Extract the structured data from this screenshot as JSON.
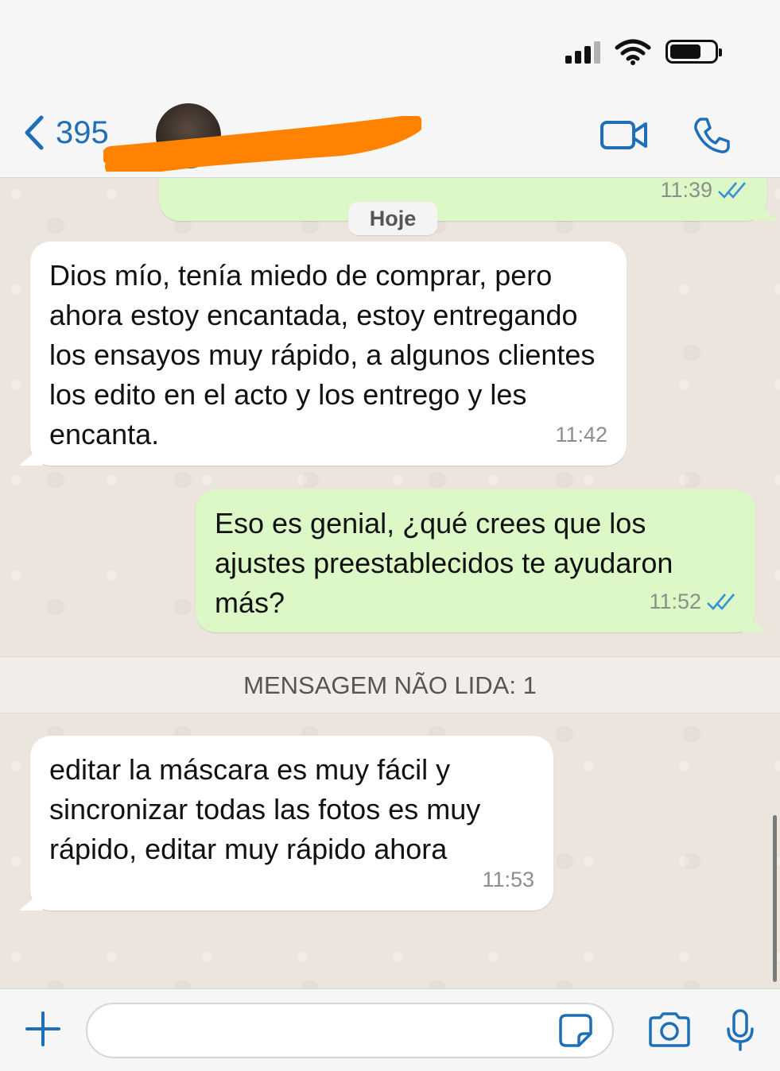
{
  "header": {
    "back_count": "395",
    "accent": "#1F6FB8"
  },
  "chat": {
    "date_chip": "Hoje",
    "top_partial_time": "11:39",
    "messages": [
      {
        "direction": "incoming",
        "text": "Dios mío, tenía miedo de comprar, pero ahora estoy encantada, estoy entregando los ensayos muy rápido, a algunos clientes los edito en el acto y los entrego y les encanta.",
        "time": "11:42"
      },
      {
        "direction": "outgoing",
        "text": "Eso es genial, ¿qué crees que los ajustes preestablecidos te ayudaron más?",
        "time": "11:52"
      },
      {
        "direction": "incoming",
        "text": "editar la máscara es muy fácil y sincronizar todas las fotos es muy rápido, editar muy rápido ahora",
        "time": "11:53"
      }
    ],
    "unread_label": "MENSAGEM NÃO LIDA: 1"
  },
  "composer": {
    "placeholder": ""
  },
  "colors": {
    "outgoing_bubble": "#DCF8C6",
    "incoming_bubble": "#FFFFFF",
    "chat_bg": "#ECE5DD",
    "read_ticks": "#3B8FD6",
    "redaction": "#FF8200"
  },
  "icons": {
    "back": "chevron-left-icon",
    "video": "video-camera-icon",
    "phone": "phone-icon",
    "plus": "plus-icon",
    "sticker": "sticker-icon",
    "camera": "camera-icon",
    "mic": "microphone-icon"
  }
}
